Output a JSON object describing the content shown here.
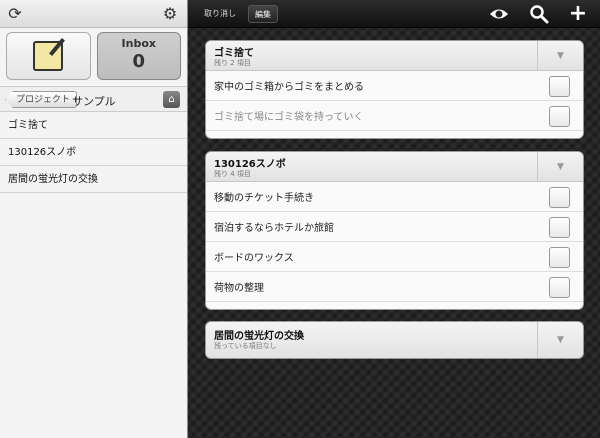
{
  "sidebar": {
    "inbox_label": "Inbox",
    "inbox_count": "0",
    "back_label": "プロジェクト",
    "project_title": "サンプル",
    "projects": [
      "ゴミ捨て",
      "130126スノボ",
      "居間の蛍光灯の交換"
    ]
  },
  "toolbar": {
    "undo_label": "取り消し",
    "edit_label": "編集"
  },
  "cards": [
    {
      "title": "ゴミ捨て",
      "subtitle": "残り 2 項目",
      "tasks": [
        "家中のゴミ箱からゴミをまとめる",
        "ゴミ捨て場にゴミ袋を持っていく"
      ]
    },
    {
      "title": "130126スノボ",
      "subtitle": "残り 4 項目",
      "tasks": [
        "移動のチケット手続き",
        "宿泊するならホテルか旅館",
        "ボードのワックス",
        "荷物の整理"
      ]
    },
    {
      "title": "居間の蛍光灯の交換",
      "subtitle": "残っている項目なし",
      "tasks": []
    }
  ],
  "icons": {
    "refresh": "refresh-icon",
    "settings": "gear-icon",
    "compose": "compose-icon",
    "home": "home-icon",
    "view": "eye-icon",
    "search": "search-icon",
    "add": "plus-icon",
    "collapse": "chevron-down-icon"
  }
}
